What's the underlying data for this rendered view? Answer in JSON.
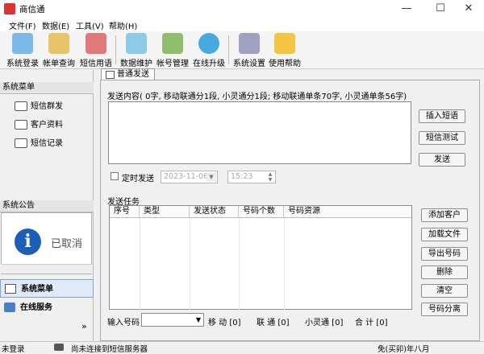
{
  "window": {
    "title": "商信通",
    "minimize": "—",
    "maximize": "☐",
    "close": "✕"
  },
  "menu": [
    "文件(F)",
    "数据(E)",
    "工具(V)",
    "帮助(H)"
  ],
  "toolbar": [
    {
      "label": "系统登录",
      "icon": "login-icon",
      "color": "#7db9e8"
    },
    {
      "label": "帐单查询",
      "icon": "bill-query-icon",
      "color": "#e9c46a"
    },
    {
      "label": "短信用语",
      "icon": "phrase-icon",
      "color": "#e07a7a"
    },
    {
      "label": "数据维护",
      "icon": "data-maintain-icon",
      "color": "#8ecae6"
    },
    {
      "label": "帐号管理",
      "icon": "account-icon",
      "color": "#90be6d"
    },
    {
      "label": "在线升级",
      "icon": "upgrade-icon",
      "color": "#48a9e0"
    },
    {
      "label": "系统设置",
      "icon": "settings-icon",
      "color": "#a0a0c0"
    },
    {
      "label": "使用帮助",
      "icon": "help-icon",
      "color": "#f4c542"
    }
  ],
  "sidebar": {
    "menu_title": "系统菜单",
    "items": [
      "短信群发",
      "客户资料",
      "短信记录"
    ],
    "notice_title": "系统公告",
    "notice_text": "已取消",
    "nav": [
      "系统菜单",
      "在线服务"
    ],
    "more": "»"
  },
  "tab": "普通发送",
  "send": {
    "info": "发送内容( 0字, 移动联通分1段, 小灵通分1段; 移动联通单条70字, 小灵通单条56字)",
    "message": "",
    "buttons": [
      "插入短语",
      "短信测试",
      "发送"
    ],
    "timer_label": "定时发送",
    "date": "2023-11-06",
    "time": "15:23"
  },
  "task": {
    "label": "发送任务",
    "columns": [
      "序号",
      "类型",
      "发送状态",
      "号码个数",
      "号码资源"
    ],
    "rows": [],
    "buttons": [
      "添加客户",
      "加载文件",
      "导出号码",
      "删除",
      "清空",
      "号码分离"
    ]
  },
  "input": {
    "label": "输入号码",
    "value": "",
    "counts": [
      "移 动 [0]",
      "联 通 [0]",
      "小灵通 [0]",
      "合 计 [0]"
    ]
  },
  "status": {
    "login": "未登录",
    "server": "尚未连接到短信服务器",
    "version": "免(买卯)年八月"
  }
}
